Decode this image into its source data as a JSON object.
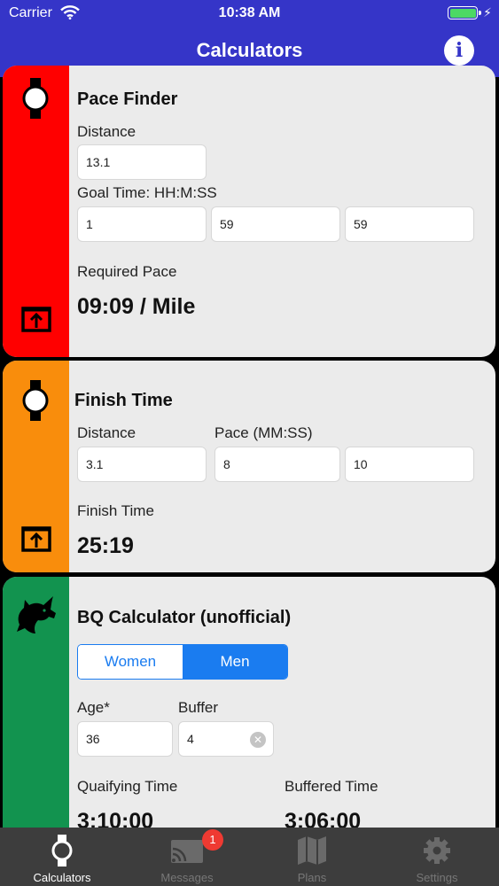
{
  "status_bar": {
    "carrier": "Carrier",
    "time": "10:38 AM",
    "charging_symbol": "⚡"
  },
  "nav": {
    "title": "Calculators",
    "info_symbol": "i"
  },
  "pace_finder": {
    "color": "#ff0000",
    "title": "Pace Finder",
    "distance_label": "Distance",
    "distance_value": "13.1",
    "goal_time_label": "Goal Time: HH:M:SS",
    "hours": "1",
    "minutes": "59",
    "seconds": "59",
    "result_label": "Required Pace",
    "result": "09:09 / Mile"
  },
  "finish_time": {
    "color": "#f98d0c",
    "title": "Finish Time",
    "distance_label": "Distance",
    "pace_label": "Pace (MM:SS)",
    "distance_value": "3.1",
    "pace_minutes": "8",
    "pace_seconds": "10",
    "result_label": "Finish Time",
    "result": "25:19"
  },
  "bq_calculator": {
    "color": "#12934f",
    "title": "BQ Calculator (unofficial)",
    "gender_options": [
      "Women",
      "Men"
    ],
    "selected_gender": "Men",
    "age_label": "Age*",
    "age_value": "36",
    "buffer_label": "Buffer",
    "buffer_value": "4",
    "qualifying_label": "Quaifying Time",
    "qualifying_value": "3:10:00",
    "buffered_label": "Buffered Time",
    "buffered_value": "3:06:00"
  },
  "tabs": [
    {
      "label": "Calculators",
      "icon": "watch-icon",
      "active": true
    },
    {
      "label": "Messages",
      "icon": "cast-icon",
      "badge": "1"
    },
    {
      "label": "Plans",
      "icon": "map-icon"
    },
    {
      "label": "Settings",
      "icon": "gear-icon"
    }
  ],
  "colors": {
    "nav": "#3535c8",
    "accent": "#1a7cf0",
    "tabbar": "#3d3d3d",
    "badge": "#ef3a32"
  }
}
